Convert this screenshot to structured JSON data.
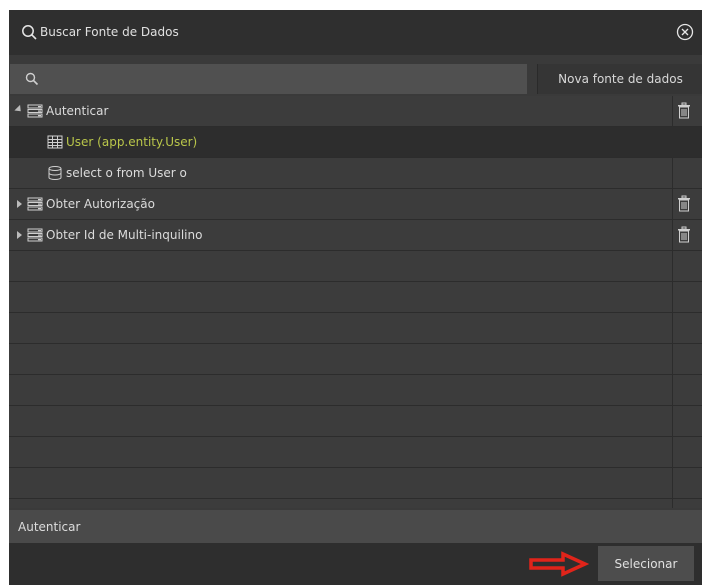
{
  "dialog": {
    "title": "Buscar Fonte de Dados",
    "search_placeholder": "",
    "new_source_label": "Nova fonte de dados"
  },
  "tree": {
    "items": [
      {
        "label": "Autenticar",
        "expanded": true,
        "icon": "datasource-icon",
        "level": 0
      },
      {
        "label": "User (app.entity.User)",
        "icon": "table-icon",
        "level": 1,
        "selected": true
      },
      {
        "label": "select o from User o",
        "icon": "database-icon",
        "level": 1
      },
      {
        "label": "Obter Autorização",
        "expanded": false,
        "icon": "datasource-icon",
        "level": 0
      },
      {
        "label": "Obter Id de Multi-inquilino",
        "expanded": false,
        "icon": "datasource-icon",
        "level": 0
      }
    ]
  },
  "status": {
    "text": "Autenticar"
  },
  "footer": {
    "select_label": "Selecionar"
  },
  "colors": {
    "selected_text": "#b9c64a",
    "arrow": "#e0241a"
  }
}
